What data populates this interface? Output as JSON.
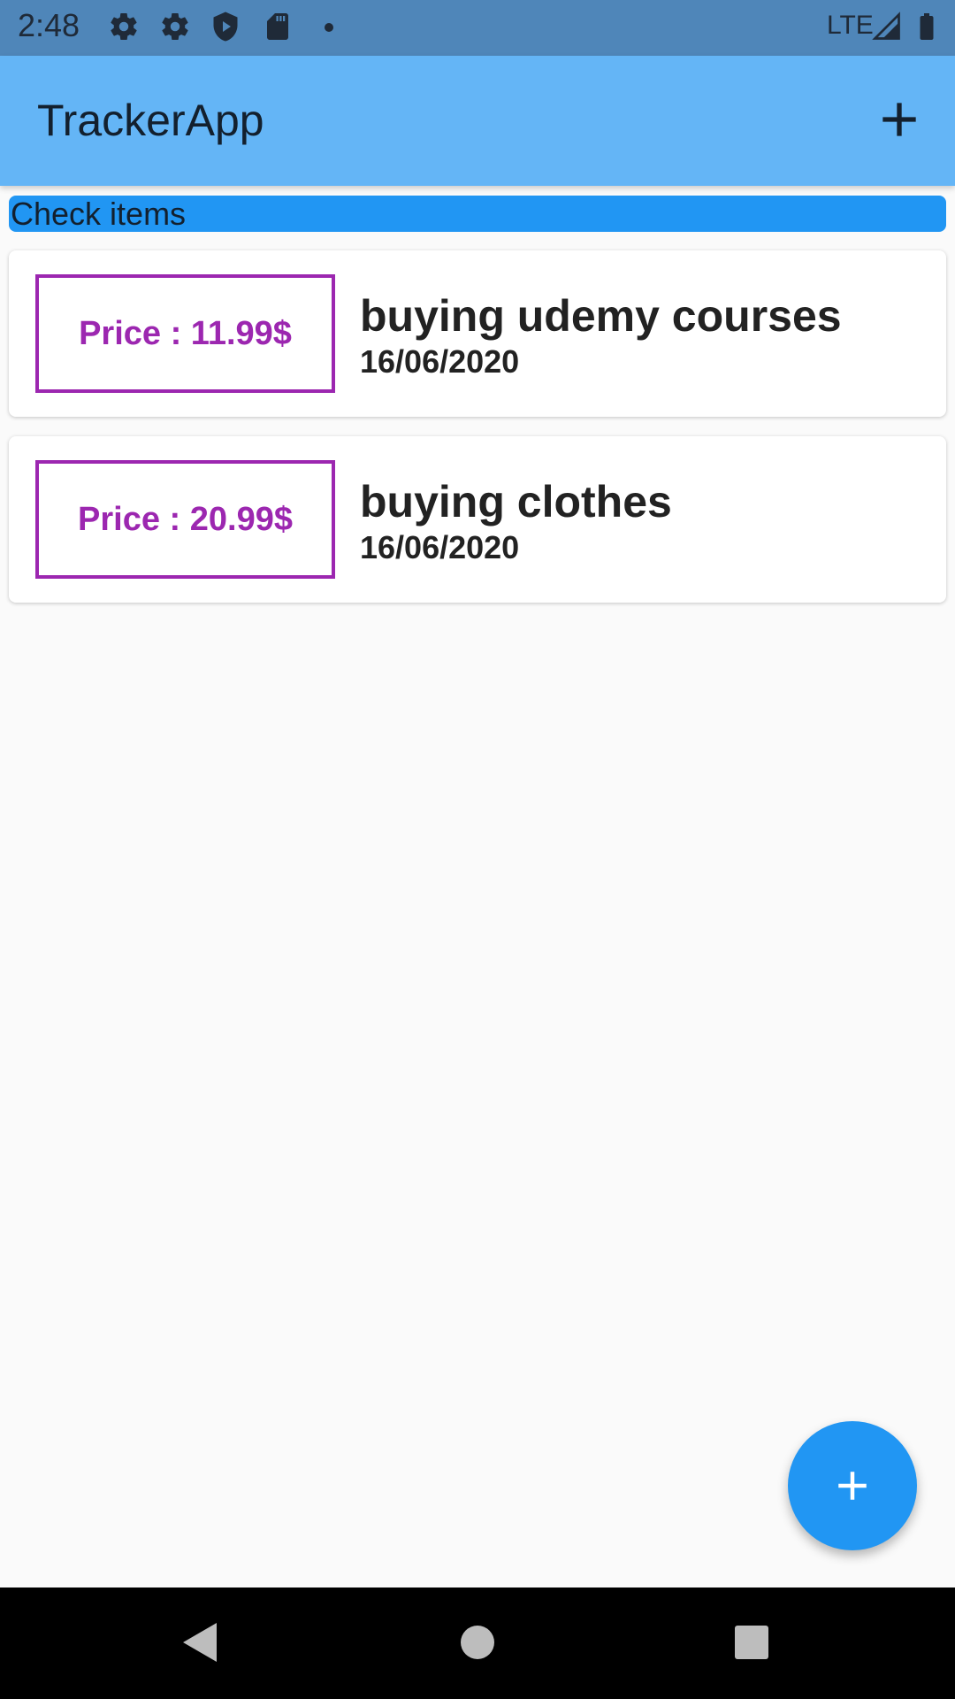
{
  "status_bar": {
    "time": "2:48",
    "network": "LTE",
    "icons": [
      "settings-gear-icon",
      "settings-gear-icon",
      "shield-play-icon",
      "sd-card-icon",
      "dot-icon",
      "signal-icon",
      "battery-icon"
    ]
  },
  "app_bar": {
    "title": "TrackerApp",
    "action_icon": "add-icon"
  },
  "check_bar": {
    "label": "Check items"
  },
  "items": [
    {
      "price": "Price : 11.99$",
      "title": "buying udemy courses",
      "date": "16/06/2020"
    },
    {
      "price": "Price : 20.99$",
      "title": "buying clothes",
      "date": "16/06/2020"
    }
  ],
  "fab": {
    "icon": "add-icon"
  },
  "nav_bar": {
    "buttons": [
      "back-icon",
      "home-icon",
      "recents-icon"
    ]
  },
  "colors": {
    "status_bar": "#4f86b9",
    "app_bar": "#64b5f6",
    "accent_blue": "#2196f3",
    "price_purple": "#9c27b0",
    "background": "#fafafa"
  }
}
